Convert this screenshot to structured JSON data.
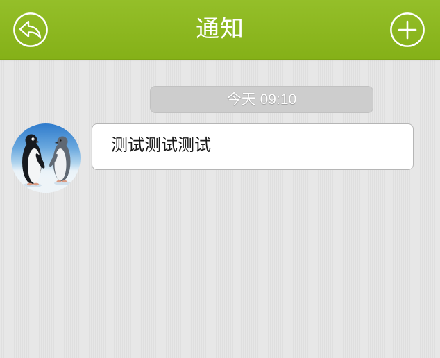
{
  "header": {
    "title": "通知",
    "back_icon": "reply-arrow-icon",
    "add_icon": "plus-icon"
  },
  "messages": [
    {
      "time": "今天 09:10",
      "avatar": "penguins-photo",
      "text": "测试测试测试"
    }
  ],
  "colors": {
    "header_bg": "#8cba19",
    "page_bg": "#e4e4e4",
    "time_pill_bg": "#cdcdcd",
    "bubble_bg": "#ffffff",
    "bubble_border": "#b5b5b5",
    "header_text": "#ffffff",
    "message_text": "#1a1a1a"
  }
}
